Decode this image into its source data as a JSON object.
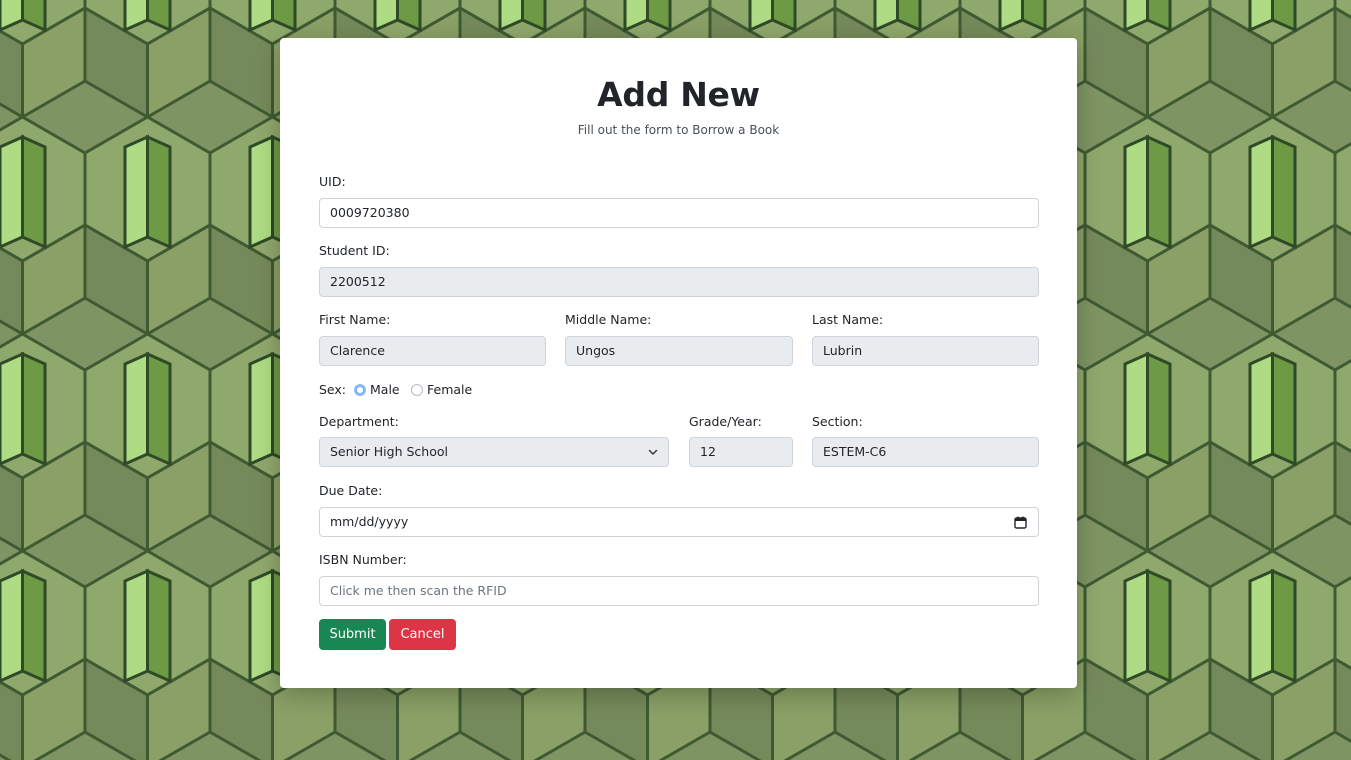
{
  "colors": {
    "background": "#7f9463",
    "submit": "#198754",
    "cancel": "#dc3545",
    "readonly_field": "#e9ecef",
    "radio_checked": "#86b7fe"
  },
  "header": {
    "title": "Add New",
    "subtitle": "Fill out the form to Borrow a Book"
  },
  "form": {
    "uid": {
      "label": "UID:",
      "value": "0009720380"
    },
    "student_id": {
      "label": "Student ID:",
      "value": "2200512"
    },
    "first_name": {
      "label": "First Name:",
      "value": "Clarence"
    },
    "middle_name": {
      "label": "Middle Name:",
      "value": "Ungos"
    },
    "last_name": {
      "label": "Last Name:",
      "value": "Lubrin"
    },
    "sex": {
      "label": "Sex:",
      "options": [
        {
          "label": "Male",
          "selected": true
        },
        {
          "label": "Female",
          "selected": false
        }
      ]
    },
    "department": {
      "label": "Department:",
      "value": "Senior High School",
      "icon": "chevron-down-icon"
    },
    "grade_year": {
      "label": "Grade/Year:",
      "value": "12"
    },
    "section": {
      "label": "Section:",
      "value": "ESTEM-C6"
    },
    "due_date": {
      "label": "Due Date:",
      "placeholder": "mm/dd/yyyy",
      "icon": "calendar-icon"
    },
    "isbn": {
      "label": "ISBN Number:",
      "placeholder": "Click me then scan the RFID"
    }
  },
  "actions": {
    "submit_label": "Submit",
    "cancel_label": "Cancel"
  }
}
